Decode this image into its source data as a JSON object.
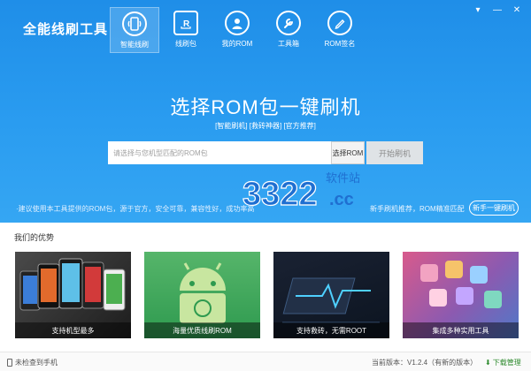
{
  "app": {
    "title": "全能线刷工具"
  },
  "window_controls": [
    {
      "icon": "window-icon",
      "glyph": "▾"
    },
    {
      "icon": "minimize-icon",
      "glyph": "—"
    },
    {
      "icon": "close-icon",
      "glyph": "✕"
    }
  ],
  "nav": {
    "items": [
      {
        "label": "智能线刷",
        "icon": "smart-flash-icon",
        "active": true
      },
      {
        "label": "线刷包",
        "icon": "rom-package-icon",
        "active": false
      },
      {
        "label": "我的ROM",
        "icon": "my-rom-icon",
        "active": false
      },
      {
        "label": "工具箱",
        "icon": "toolbox-icon",
        "active": false
      },
      {
        "label": "ROM签名",
        "icon": "rom-sign-icon",
        "active": false
      }
    ]
  },
  "hero": {
    "headline": "选择ROM包一键刷机",
    "subtags": "[智能刷机] [救砖神器] [官方推荐]",
    "search_placeholder": "请选择与您机型匹配的ROM包",
    "select_label": "选择ROM",
    "start_label": "开始刷机",
    "tip_left": "·建议使用本工具提供的ROM包，源于官方，安全可靠，兼容性好，成功率高",
    "tip_right": "新手刷机推荐，ROM精准匹配",
    "newbie_label": "新手一键刷机"
  },
  "watermark": {
    "text": "3322",
    "domain": ".cc",
    "site": "软件站"
  },
  "advantages": {
    "title": "我们的优势",
    "cards": [
      {
        "caption": "支持机型最多"
      },
      {
        "caption": "海量优质线刷ROM"
      },
      {
        "caption": "支持救砖，无需ROOT"
      },
      {
        "caption": "集成多种实用工具"
      }
    ]
  },
  "status": {
    "device": "未检查到手机",
    "version": "当前版本：V1.2.4（有新的版本）",
    "download": "下载管理"
  },
  "colors": {
    "hero": "#2a9cf0",
    "download": "#2d8a2d",
    "watermark": "#1f6fd1"
  }
}
